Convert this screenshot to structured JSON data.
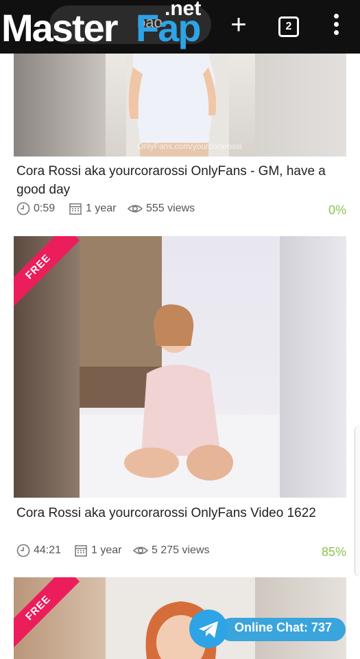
{
  "browser": {
    "url_fragment": "bao",
    "tab_count": "2"
  },
  "logo": {
    "part1": "Master",
    "part2": "Fap",
    "suffix": ".net"
  },
  "videos": [
    {
      "title": "Cora Rossi aka yourcorarossi OnlyFans - GM, have a good day",
      "duration": "0:59",
      "age": "1 year",
      "views": "555 views",
      "rating": "0%",
      "free": false,
      "watermark": "OnlyFans.com/yourcorarossi"
    },
    {
      "title": "Cora Rossi aka yourcorarossi OnlyFans Video 1622",
      "duration": "44:21",
      "age": "1 year",
      "views": "5 275 views",
      "rating": "85%",
      "free": true,
      "free_label": "FREE"
    },
    {
      "free": true,
      "free_label": "FREE"
    }
  ],
  "chat": {
    "label": "Online Chat: 737"
  },
  "colors": {
    "accent": "#2ea3e6",
    "rating": "#8bc34a",
    "ribbon": "#ec1d5b"
  }
}
